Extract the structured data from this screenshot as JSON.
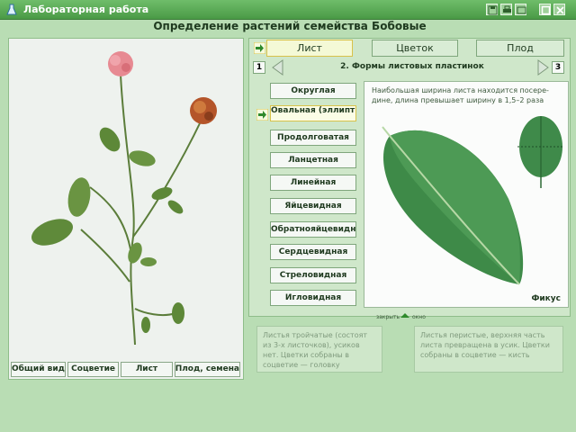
{
  "window": {
    "title": "Лабораторная работа"
  },
  "main_title": "Определение растений семейства Бобовые",
  "view_tabs": [
    "Общий вид",
    "Соцветие",
    "Лист",
    "Плод, семена"
  ],
  "main_tabs": [
    "Лист",
    "Цветок",
    "Плод"
  ],
  "nav": {
    "prev": "1",
    "next": "3",
    "title": "2. Формы листовых пластинок"
  },
  "shapes": [
    "Округлая",
    "Овальная (эллиптическая)",
    "Продолговатая",
    "Ланцетная",
    "Линейная",
    "Яйцевидная",
    "Обратнояйцевидная",
    "Сердцевидная",
    "Стреловидная",
    "Игловидная"
  ],
  "leaf": {
    "description": "Наибольшая ширина листа находится посере-дине, длина превышает ширину в 1,5–2 раза",
    "name": "Фикус"
  },
  "slider": {
    "left": "закрыть",
    "right": "окно"
  },
  "info": {
    "left": "Листья тройчатые (состоят из 3-х листочков), усиков нет. Цветки собраны в соцветие — головку",
    "right": "Листья перистые, верхняя часть листа превращена в усик. Цветки собраны в соцветие — кисть"
  },
  "colors": {
    "accent": "#4a9a46",
    "background": "#b9ddb4",
    "active_tab": "#f4f9d6",
    "leaf": "#3f8a4a"
  }
}
